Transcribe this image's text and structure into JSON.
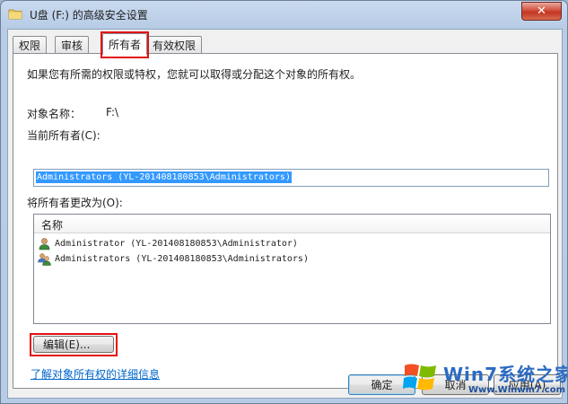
{
  "window": {
    "title": "U盘 (F:) 的高级安全设置",
    "close_label": "✕"
  },
  "tabs": [
    {
      "label": "权限"
    },
    {
      "label": "审核"
    },
    {
      "label": "所有者"
    },
    {
      "label": "有效权限"
    }
  ],
  "owner_panel": {
    "intro": "如果您有所需的权限或特权，您就可以取得或分配这个对象的所有权。",
    "object_name_label": "对象名称：",
    "object_name_value": "F:\\",
    "current_owner_label": "当前所有者(C):",
    "current_owner_value": "Administrators (YL-201408180853\\Administrators)",
    "change_owner_label": "将所有者更改为(O):",
    "list_header": "名称",
    "list_items": [
      {
        "text": "Administrator (YL-201408180853\\Administrator)",
        "icon": "user-icon"
      },
      {
        "text": "Administrators (YL-201408180853\\Administrators)",
        "icon": "group-icon"
      }
    ],
    "edit_button": "编辑(E)...",
    "learn_more_link": "了解对象所有权的详细信息"
  },
  "footer": {
    "ok_button": "确定",
    "cancel_button": "取消",
    "apply_button": "应用(A)"
  },
  "watermark": {
    "logo_text": "Win7系统之家",
    "url": "Www.Winwin7.com"
  }
}
